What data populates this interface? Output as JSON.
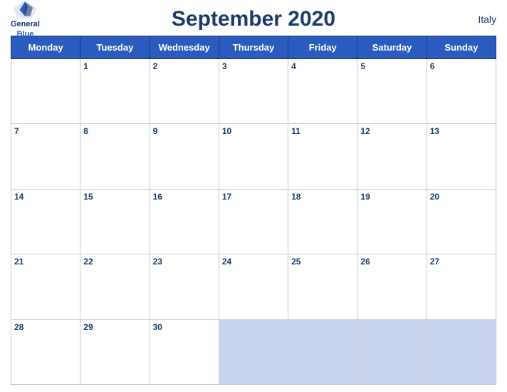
{
  "header": {
    "logo_line1": "General",
    "logo_line2": "Blue",
    "title": "September 2020",
    "country": "Italy"
  },
  "days_of_week": [
    "Monday",
    "Tuesday",
    "Wednesday",
    "Thursday",
    "Friday",
    "Saturday",
    "Sunday"
  ],
  "weeks": [
    {
      "days": [
        {
          "num": "",
          "empty": true
        },
        {
          "num": "1"
        },
        {
          "num": "2"
        },
        {
          "num": "3"
        },
        {
          "num": "4"
        },
        {
          "num": "5"
        },
        {
          "num": "6"
        }
      ]
    },
    {
      "days": [
        {
          "num": "7"
        },
        {
          "num": "8"
        },
        {
          "num": "9"
        },
        {
          "num": "10"
        },
        {
          "num": "11"
        },
        {
          "num": "12"
        },
        {
          "num": "13"
        }
      ]
    },
    {
      "days": [
        {
          "num": "14"
        },
        {
          "num": "15"
        },
        {
          "num": "16"
        },
        {
          "num": "17"
        },
        {
          "num": "18"
        },
        {
          "num": "19"
        },
        {
          "num": "20"
        }
      ]
    },
    {
      "days": [
        {
          "num": "21"
        },
        {
          "num": "22"
        },
        {
          "num": "23"
        },
        {
          "num": "24"
        },
        {
          "num": "25"
        },
        {
          "num": "26"
        },
        {
          "num": "27"
        }
      ]
    },
    {
      "days": [
        {
          "num": "28"
        },
        {
          "num": "29"
        },
        {
          "num": "30"
        },
        {
          "num": "",
          "out": true
        },
        {
          "num": "",
          "out": true
        },
        {
          "num": "",
          "out": true
        },
        {
          "num": "",
          "out": true
        }
      ]
    }
  ]
}
